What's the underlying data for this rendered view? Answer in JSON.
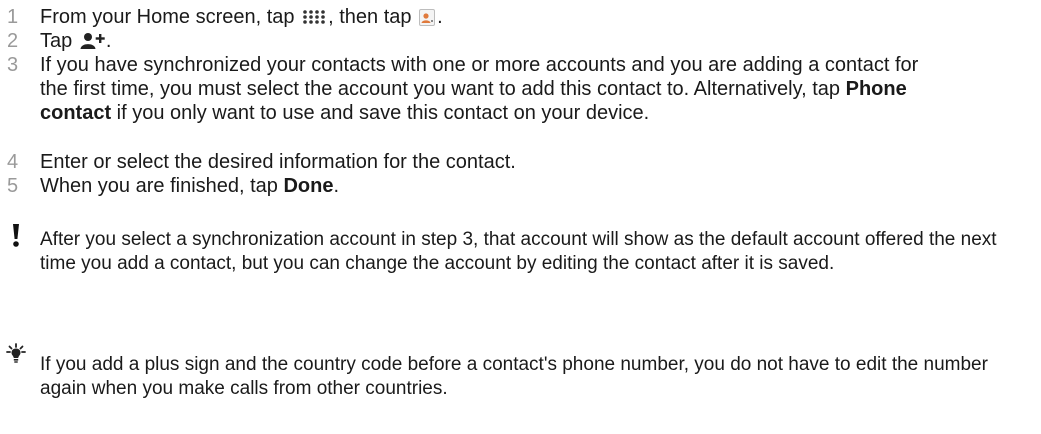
{
  "steps": [
    {
      "num": "1",
      "before": "From your Home screen, tap ",
      "apps_icon": "apps-grid-icon",
      "middle": ", then tap ",
      "contacts_icon": "contacts-app-icon",
      "after": "."
    },
    {
      "num": "2",
      "before": "Tap ",
      "add_icon": "add-contact-icon",
      "after": "."
    },
    {
      "num": "3",
      "before": "If you have synchronized your contacts with one or more accounts and you are adding a contact for the first time, you must select the account you want to add this contact to. Alternatively, tap ",
      "bold": "Phone contact",
      "after": " if you only want to use and save this contact on your device."
    },
    {
      "num": "4",
      "text": "Enter or select the desired information for the contact."
    },
    {
      "num": "5",
      "before": "When you are finished, tap ",
      "bold": "Done",
      "after": "."
    }
  ],
  "notes": [
    {
      "icon": "exclamation-icon",
      "text": "After you select a synchronization account in step 3, that account will show as the default account offered the next time you add a contact, but you can change the account by editing the contact after it is saved."
    },
    {
      "icon": "lightbulb-tip-icon",
      "text": "If you add a plus sign and the country code before a contact's phone number, you do not have to edit the number again when you make calls from other countries."
    }
  ],
  "colors": {
    "step_number": "#9a9a9a",
    "body_text": "#1a1a1a",
    "contacts_icon_accent": "#e07a3c"
  }
}
